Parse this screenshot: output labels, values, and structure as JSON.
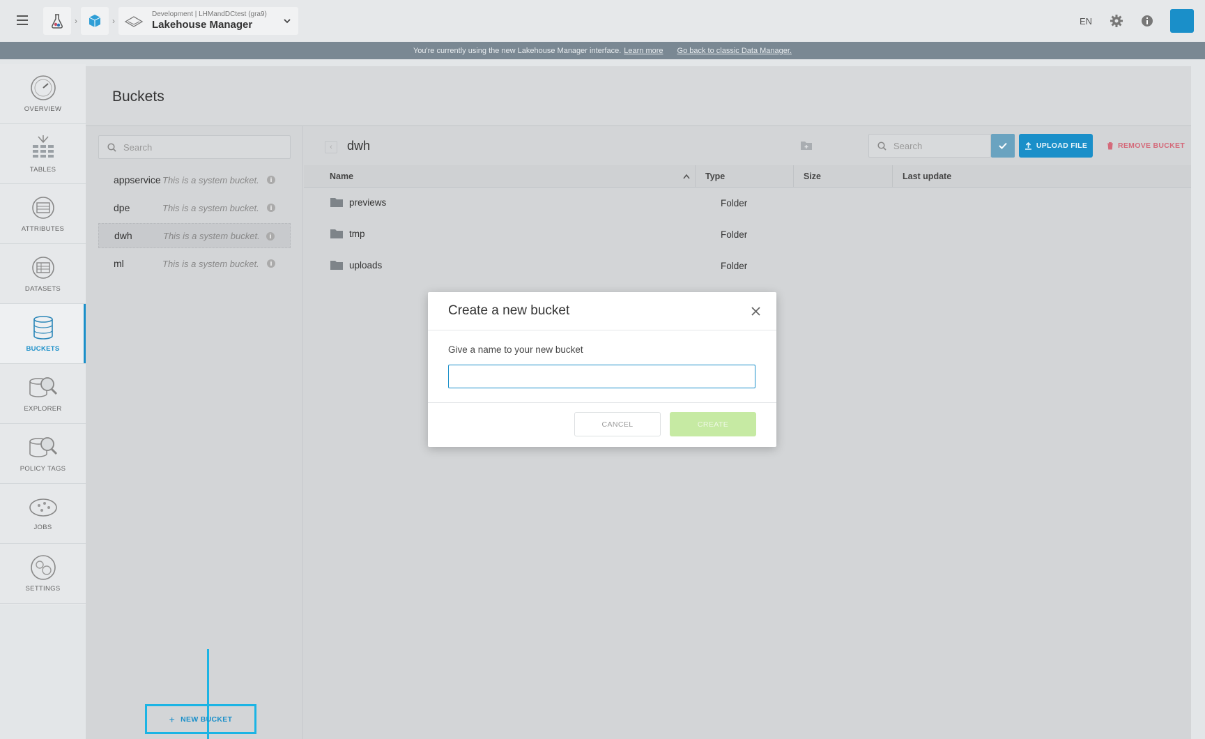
{
  "topbar": {
    "breadcrumb_sub": "Development | LHMandDCtest (gra9)",
    "breadcrumb_title": "Lakehouse Manager",
    "language": "EN"
  },
  "banner": {
    "text": "You're currently using the new Lakehouse Manager interface.",
    "learn_more": "Learn more",
    "go_back": "Go back to classic Data Manager."
  },
  "sidebar": {
    "items": [
      {
        "label": "OVERVIEW",
        "icon": "gauge-icon"
      },
      {
        "label": "TABLES",
        "icon": "tables-icon"
      },
      {
        "label": "ATTRIBUTES",
        "icon": "attributes-icon"
      },
      {
        "label": "DATASETS",
        "icon": "datasets-icon"
      },
      {
        "label": "BUCKETS",
        "icon": "buckets-icon",
        "active": true
      },
      {
        "label": "EXPLORER",
        "icon": "explorer-icon"
      },
      {
        "label": "POLICY TAGS",
        "icon": "policy-tags-icon"
      },
      {
        "label": "JOBS",
        "icon": "jobs-icon"
      },
      {
        "label": "SETTINGS",
        "icon": "settings-icon"
      }
    ]
  },
  "page": {
    "title": "Buckets"
  },
  "bucket_list": {
    "search_placeholder": "Search",
    "items": [
      {
        "name": "appservice",
        "desc": "This is a system bucket."
      },
      {
        "name": "dpe",
        "desc": "This is a system bucket."
      },
      {
        "name": "dwh",
        "desc": "This is a system bucket.",
        "selected": true
      },
      {
        "name": "ml",
        "desc": "This is a system bucket."
      }
    ],
    "new_bucket_label": "NEW BUCKET"
  },
  "content": {
    "path": "dwh",
    "search_placeholder": "Search",
    "upload_label": "UPLOAD FILE",
    "remove_label": "REMOVE BUCKET",
    "columns": [
      "Name",
      "Type",
      "Size",
      "Last update"
    ],
    "rows": [
      {
        "name": "previews",
        "type": "Folder"
      },
      {
        "name": "tmp",
        "type": "Folder"
      },
      {
        "name": "uploads",
        "type": "Folder"
      }
    ]
  },
  "modal": {
    "title": "Create a new bucket",
    "label": "Give a name to your new bucket",
    "input_value": "",
    "cancel_label": "CANCEL",
    "create_label": "CREATE"
  }
}
